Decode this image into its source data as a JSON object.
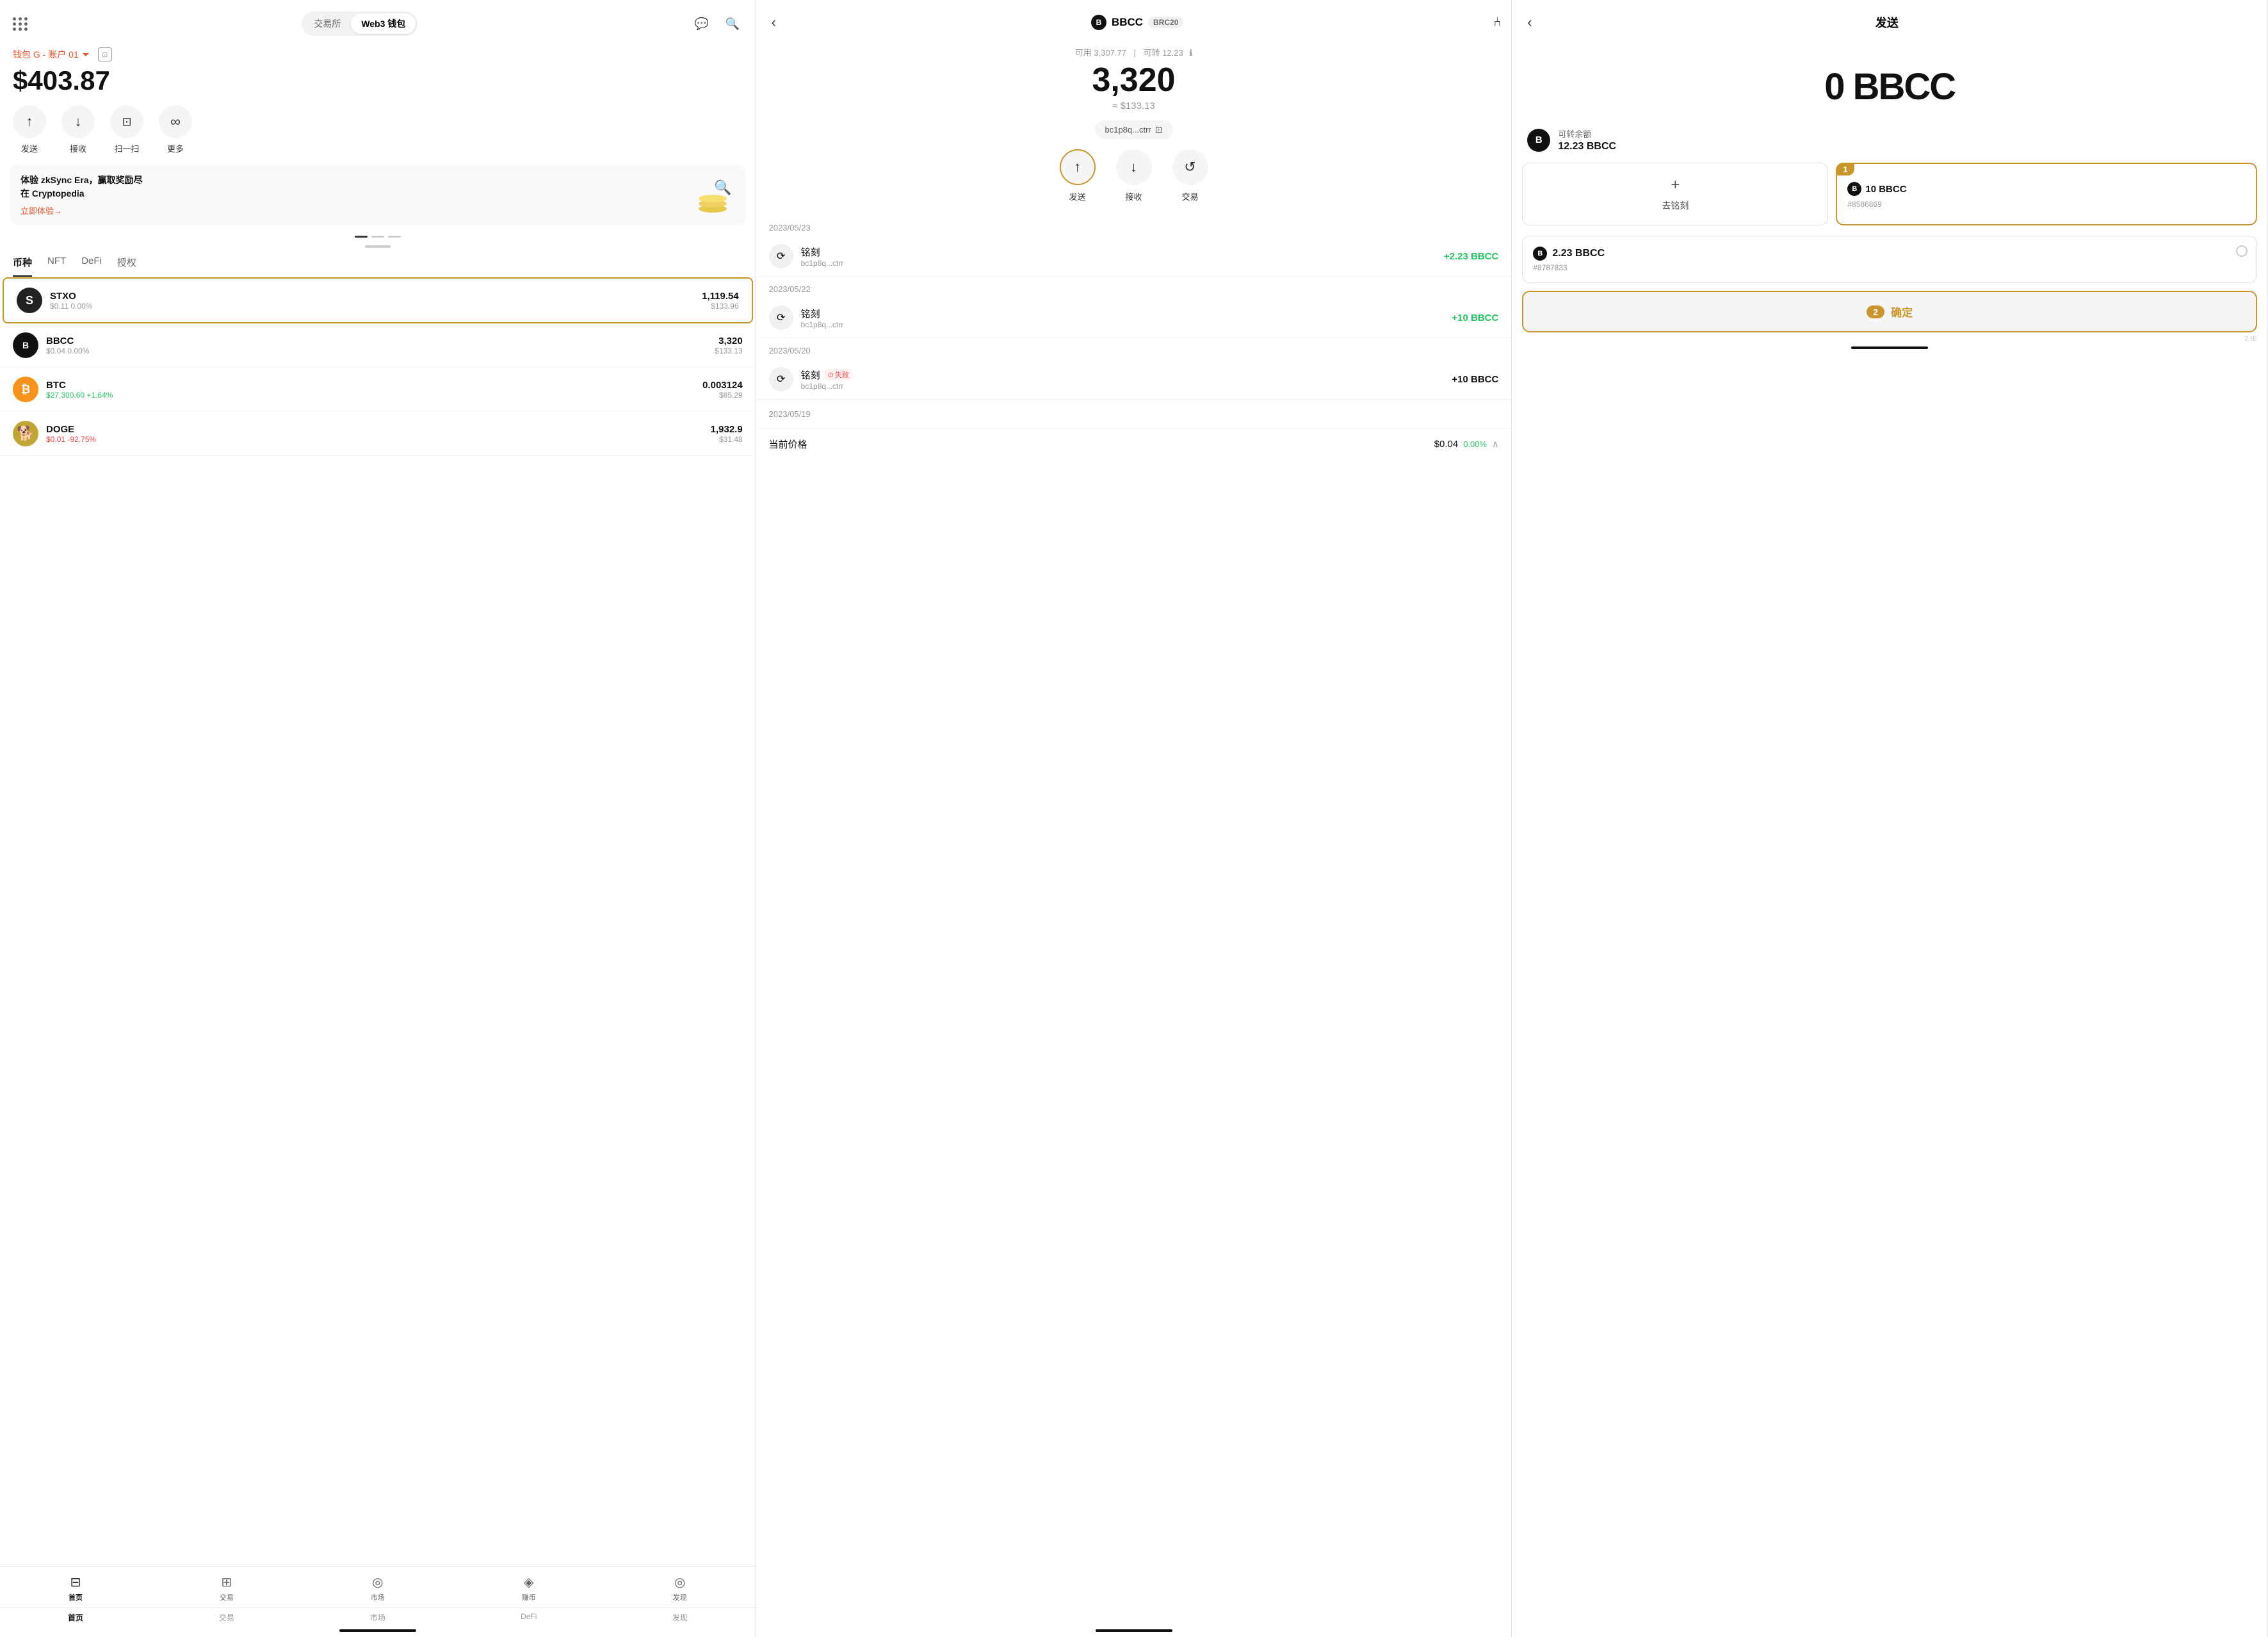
{
  "panel1": {
    "tabs": [
      "交易所",
      "Web3 钱包"
    ],
    "active_tab": "Web3 钱包",
    "account_label": "钱包 G - 账户 01",
    "balance": "$403.87",
    "actions": [
      {
        "label": "发送",
        "icon": "↑"
      },
      {
        "label": "接收",
        "icon": "↓"
      },
      {
        "label": "扫一扫",
        "icon": "⊡"
      },
      {
        "label": "更多",
        "icon": "∞"
      }
    ],
    "banner": {
      "title": "体验 zkSync Era，赢取奖励尽\n在 Cryptopedia",
      "link": "立即体验→"
    },
    "coin_tabs": [
      "币种",
      "NFT",
      "DeFi",
      "授权"
    ],
    "active_coin_tab": "币种",
    "coins": [
      {
        "symbol": "S",
        "name": "STXO",
        "price": "$0.11",
        "change": "0.00%",
        "change_dir": "neutral",
        "amount": "1,119.54",
        "usd": "$133.96",
        "highlighted": true
      },
      {
        "symbol": "B",
        "name": "BBCC",
        "price": "$0.04",
        "change": "0.00%",
        "change_dir": "neutral",
        "amount": "3,320",
        "usd": "$133.13",
        "highlighted": false
      },
      {
        "symbol": "₿",
        "name": "BTC",
        "price": "$27,300.60",
        "change": "+1.64%",
        "change_dir": "up",
        "amount": "0.003124",
        "usd": "$85.29",
        "highlighted": false
      },
      {
        "symbol": "Ð",
        "name": "DOGE",
        "price": "$0.01",
        "change": "-92.75%",
        "change_dir": "down",
        "amount": "1,932.9",
        "usd": "$31.48",
        "highlighted": false
      }
    ],
    "bottom_nav": [
      {
        "label": "首页",
        "icon": "⊟",
        "active": true
      },
      {
        "label": "交易",
        "icon": "⊞"
      },
      {
        "label": "市场",
        "icon": "◎"
      },
      {
        "label": "赚币",
        "icon": "◈"
      },
      {
        "label": "发现",
        "icon": "◎"
      }
    ],
    "bottom_tabs": [
      "首页",
      "交易",
      "市场",
      "DeFi",
      "发现"
    ]
  },
  "panel2": {
    "coin_name": "BBCC",
    "coin_badge": "BRC20",
    "available": "可用 3,307.77",
    "transferable": "可转 12.23",
    "main_balance": "3,320",
    "usd_value": "≈ $133.13",
    "address": "bc1p8q...ctrr",
    "actions": [
      {
        "label": "发送",
        "icon": "↑",
        "highlighted": true
      },
      {
        "label": "接收",
        "icon": "↓"
      },
      {
        "label": "交易",
        "icon": "↺"
      }
    ],
    "transactions": [
      {
        "date": "2023/05/23",
        "items": [
          {
            "type": "铭刻",
            "address": "bc1p8q...ctrr",
            "amount": "+2.23 BBCC",
            "positive": true,
            "failed": false
          }
        ]
      },
      {
        "date": "2023/05/22",
        "items": [
          {
            "type": "铭刻",
            "address": "bc1p8q...ctrr",
            "amount": "+10 BBCC",
            "positive": true,
            "failed": false
          }
        ]
      },
      {
        "date": "2023/05/20",
        "items": [
          {
            "type": "铭刻",
            "address": "bc1p8q...ctrr",
            "amount": "+10 BBCC",
            "positive": false,
            "failed": true,
            "fail_label": "失败"
          }
        ]
      }
    ],
    "price_section": {
      "date": "2023/05/19",
      "label": "当前价格",
      "value": "$0.04",
      "change": "0.00%"
    }
  },
  "panel3": {
    "title": "发送",
    "amount": "0 BBCC",
    "transferable_label": "可转余额",
    "transferable_amount": "12.23 BBCC",
    "cards": [
      {
        "type": "add",
        "plus": "+",
        "label": "去铭刻"
      },
      {
        "type": "item",
        "num": 1,
        "amount": "10 BBCC",
        "id": "#8586869"
      }
    ],
    "card2": {
      "amount": "2.23 BBCC",
      "id": "#8787833"
    },
    "confirm_num": 2,
    "confirm_label": "确定",
    "bottom_note": "2 tE"
  }
}
